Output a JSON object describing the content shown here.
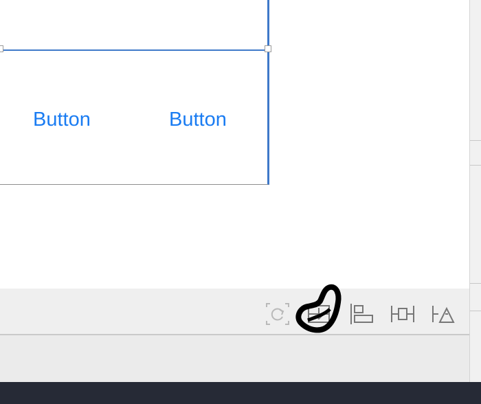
{
  "canvas": {
    "buttons": [
      {
        "label": "Button"
      },
      {
        "label": "Button"
      }
    ]
  },
  "toolbar": {
    "tools": [
      {
        "name": "update-frames"
      },
      {
        "name": "embed-in-stack"
      },
      {
        "name": "align"
      },
      {
        "name": "add-constraints"
      },
      {
        "name": "resolve-layout-issues"
      }
    ]
  },
  "colors": {
    "accent": "#1a7cf2",
    "selection": "#3f79c9",
    "bottom_bar": "#262a36",
    "annotation": "#000000"
  }
}
